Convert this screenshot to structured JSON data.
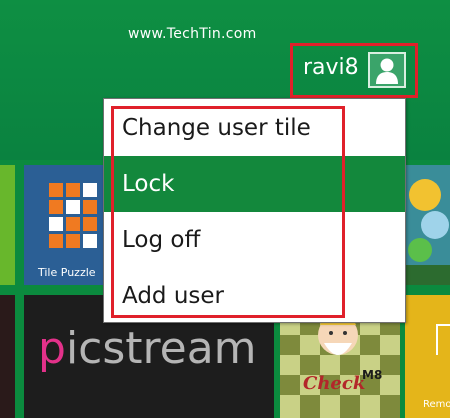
{
  "watermark": "www.TechTin.com",
  "user": {
    "name": "ravi8",
    "avatar_icon": "user-icon"
  },
  "menu": {
    "items": [
      {
        "label": "Change user tile",
        "selected": false
      },
      {
        "label": "Lock",
        "selected": true
      },
      {
        "label": "Log off",
        "selected": false
      },
      {
        "label": "Add user",
        "selected": false
      }
    ]
  },
  "tiles": {
    "tile_puzzle": "Tile Puzzle",
    "picstream": {
      "p": "p",
      "rest": "icstream"
    },
    "check_m8": {
      "check": "Check",
      "m8": "M8"
    },
    "remote": "Remo"
  },
  "colors": {
    "start_bg": "#0b8a3e",
    "selected_item": "#13883c",
    "highlight_border": "#e0202a"
  }
}
